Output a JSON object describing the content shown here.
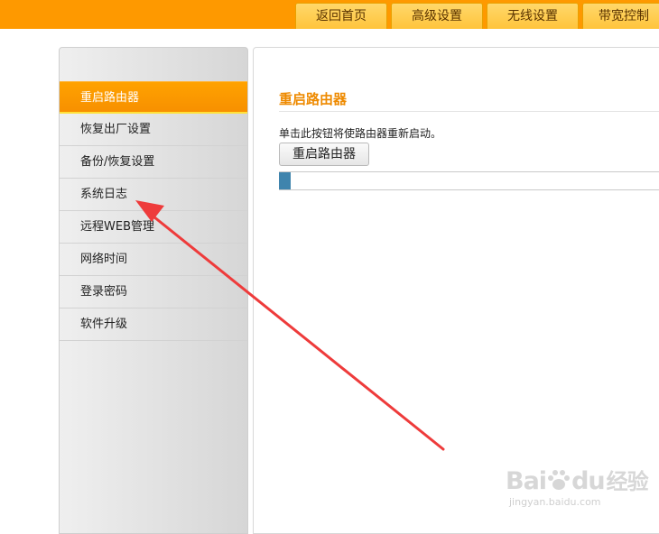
{
  "top_nav": {
    "tabs": [
      {
        "label": "返回首页"
      },
      {
        "label": "高级设置"
      },
      {
        "label": "无线设置"
      },
      {
        "label": "带宽控制"
      }
    ]
  },
  "sidebar": {
    "items": [
      {
        "label": "重启路由器",
        "active": true
      },
      {
        "label": "恢复出厂设置",
        "active": false
      },
      {
        "label": "备份/恢复设置",
        "active": false
      },
      {
        "label": "系统日志",
        "active": false
      },
      {
        "label": "远程WEB管理",
        "active": false
      },
      {
        "label": "网络时间",
        "active": false
      },
      {
        "label": "登录密码",
        "active": false
      },
      {
        "label": "软件升级",
        "active": false
      }
    ]
  },
  "main": {
    "title": "重启路由器",
    "description": "单击此按钮将使路由器重新启动。",
    "reboot_button": "重启路由器",
    "progress": 0.03
  },
  "watermark": {
    "brand_left": "Bai",
    "brand_right": "du",
    "brand_cn": "经验",
    "url": "jingyan.baidu.com"
  },
  "colors": {
    "top_bar": "#fe9900",
    "accent": "#ee8a00",
    "active_item": "#ffa200",
    "progress_fill": "#3f84ad",
    "annotation_arrow": "#ee3b3b"
  }
}
